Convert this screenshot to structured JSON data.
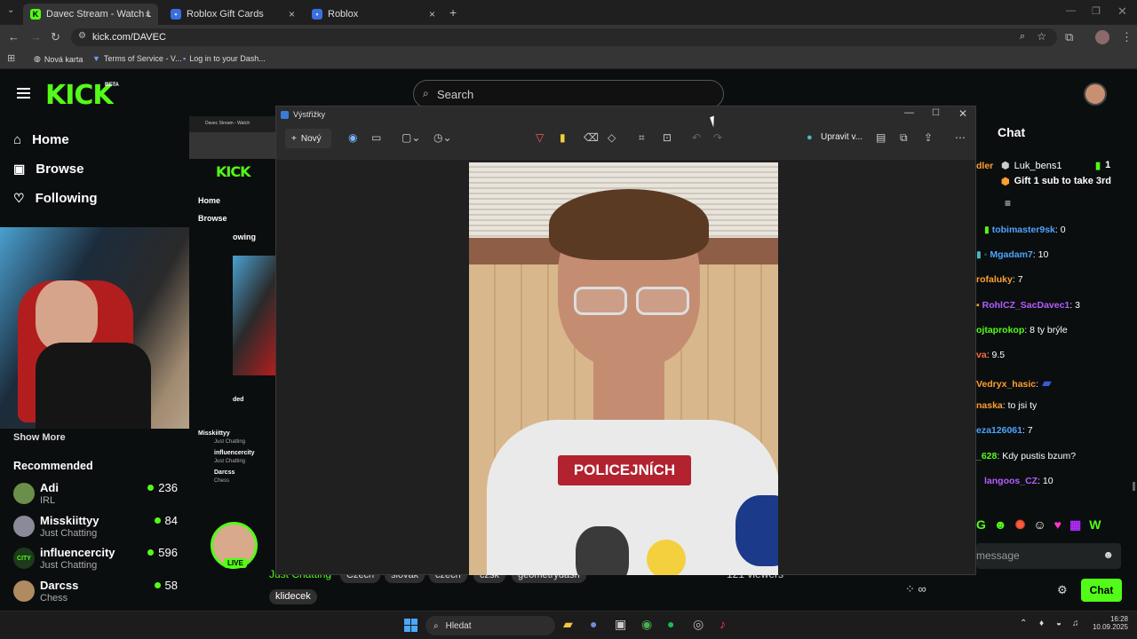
{
  "tabs": [
    {
      "title": "Davec Stream - Watch Live on K",
      "active": true
    },
    {
      "title": "Roblox Gift Cards",
      "active": false
    },
    {
      "title": "Roblox",
      "active": false
    }
  ],
  "url": "kick.com/DAVEC",
  "bookmarks": [
    "Nová karta",
    "Terms of Service - V...",
    "Log in to your Dash..."
  ],
  "kick": {
    "beta": "BETA",
    "search_placeholder": "Search",
    "nav": [
      "Home",
      "Browse",
      "Following"
    ],
    "show_more": "Show More",
    "recommended_title": "Recommended",
    "recommended": [
      {
        "name": "Adi",
        "category": "IRL",
        "viewers": "236"
      },
      {
        "name": "Misskiittyy",
        "category": "Just Chatting",
        "viewers": "84"
      },
      {
        "name": "influencercity",
        "category": "Just Chatting",
        "viewers": "596"
      },
      {
        "name": "Darcss",
        "category": "Chess",
        "viewers": "58"
      }
    ],
    "live_badge": "LIVE",
    "stream_category": "Just Chatting",
    "tags": [
      "Czech",
      "slovak",
      "czech",
      "czsk",
      "geometrydash",
      "klidecek"
    ],
    "viewers": "121 viewers",
    "chat_title": "Chat",
    "chat_placeholder": "message",
    "chat_button": "Chat"
  },
  "nested": {
    "home": "Home",
    "browse": "Browse",
    "following": "owing",
    "ended": "ded",
    "items": [
      {
        "name": "Misskiittyy",
        "cat": "Just Chatting"
      },
      {
        "name": "influencercity",
        "cat": "Just Chatting"
      },
      {
        "name": "Darcss",
        "cat": "Chess"
      }
    ]
  },
  "snip": {
    "title": "Výstřižky",
    "new_label": "Nový",
    "edit_label": "Upravit v...",
    "caption": "POLICEJNÍCH"
  },
  "chat": [
    {
      "user": "dler",
      "text": "",
      "color": "#ff9f2f"
    },
    {
      "user": "tobimaster9sk",
      "text": ": 0",
      "color": "#4da3ff"
    },
    {
      "user": "Mgadam7",
      "text": ": 10",
      "color": "#4da3ff"
    },
    {
      "user": "rofaluky",
      "text": ": 7",
      "color": "#ff9f2f"
    },
    {
      "user": "RohlCZ_SacDavec1",
      "text": ": 3",
      "color": "#b45cff"
    },
    {
      "user": "ojtaprokop",
      "text": ": 8 ty brýle",
      "color": "#53fc18"
    },
    {
      "user": "va",
      "text": ": 9.5",
      "color": "#ff6b3d"
    },
    {
      "user": "Vedryx_hasic",
      "text": ":",
      "color": "#ff9f2f"
    },
    {
      "user": "naska",
      "text": ": to jsi ty",
      "color": "#ff9f2f"
    },
    {
      "user": "eza126061",
      "text": ": 7",
      "color": "#4da3ff"
    },
    {
      "user": "_628",
      "text": ": Kdy pustis bzum?",
      "color": "#53fc18"
    },
    {
      "user": "langoos_CZ",
      "text": ": 10",
      "color": "#b45cff"
    }
  ],
  "pinned": {
    "user": "Luk_bens1",
    "count": "1",
    "gift": "Gift 1 sub to take 3rd"
  },
  "taskbar": {
    "search": "Hledat",
    "time": "16:28",
    "date": "10.09.2025"
  },
  "colors": {
    "kick_green": "#53fc18",
    "bg": "#0b0e0f"
  }
}
